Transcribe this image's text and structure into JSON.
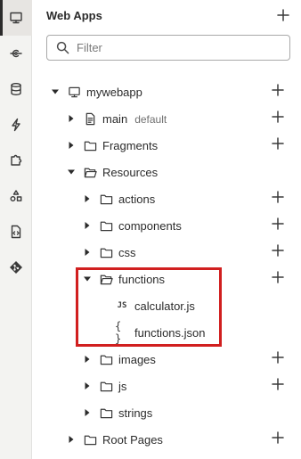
{
  "panel": {
    "title": "Web Apps",
    "search_placeholder": "Filter"
  },
  "activity_bar": {
    "items": [
      {
        "name": "web-apps",
        "icon": "monitor-icon",
        "active": true
      },
      {
        "name": "services",
        "icon": "service-connection-icon",
        "active": false
      },
      {
        "name": "business-objects",
        "icon": "database-icon",
        "active": false
      },
      {
        "name": "processes",
        "icon": "lightning-icon",
        "active": false
      },
      {
        "name": "components",
        "icon": "puzzle-icon",
        "active": false
      },
      {
        "name": "layouts",
        "icon": "shapes-icon",
        "active": false
      },
      {
        "name": "source",
        "icon": "file-code-icon",
        "active": false
      },
      {
        "name": "git",
        "icon": "git-icon",
        "active": false
      }
    ]
  },
  "tree": [
    {
      "label": "mywebapp",
      "icon": "monitor-icon",
      "expanded": true,
      "add": true
    },
    {
      "label": "main",
      "sublabel": "default",
      "icon": "page-icon",
      "expanded": false,
      "add": true
    },
    {
      "label": "Fragments",
      "icon": "folder-icon",
      "expanded": false,
      "add": true
    },
    {
      "label": "Resources",
      "icon": "folder-open-icon",
      "expanded": true,
      "add": false
    },
    {
      "label": "actions",
      "icon": "folder-icon",
      "expanded": false,
      "add": true
    },
    {
      "label": "components",
      "icon": "folder-icon",
      "expanded": false,
      "add": true
    },
    {
      "label": "css",
      "icon": "folder-icon",
      "expanded": false,
      "add": true
    },
    {
      "label": "functions",
      "icon": "folder-open-icon",
      "expanded": true,
      "add": true
    },
    {
      "label": "calculator.js",
      "icon": "js-file-icon",
      "glyph": "JS",
      "add": false
    },
    {
      "label": "functions.json",
      "icon": "json-file-icon",
      "glyph": "{ }",
      "add": false
    },
    {
      "label": "images",
      "icon": "folder-icon",
      "expanded": false,
      "add": true
    },
    {
      "label": "js",
      "icon": "folder-icon",
      "expanded": false,
      "add": true
    },
    {
      "label": "strings",
      "icon": "folder-icon",
      "expanded": false,
      "add": false
    },
    {
      "label": "Root Pages",
      "icon": "folder-icon",
      "expanded": false,
      "add": true
    }
  ],
  "colors": {
    "highlight": "#d11f1f",
    "activity_bar_bg": "#f3f3f1"
  }
}
